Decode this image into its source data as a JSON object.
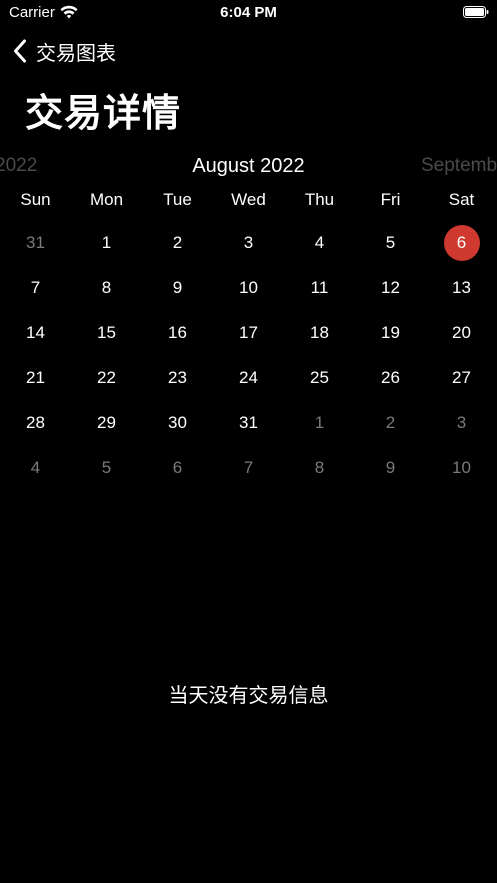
{
  "status_bar": {
    "carrier": "Carrier",
    "time": "6:04 PM"
  },
  "nav": {
    "back_label": "交易图表",
    "title": "交易详情"
  },
  "calendar": {
    "prev_month": "2022",
    "current_month": "August 2022",
    "next_month": "Septemb",
    "weekdays": [
      "Sun",
      "Mon",
      "Tue",
      "Wed",
      "Thu",
      "Fri",
      "Sat"
    ],
    "weeks": [
      [
        {
          "d": "31",
          "in_month": false
        },
        {
          "d": "1",
          "in_month": true
        },
        {
          "d": "2",
          "in_month": true
        },
        {
          "d": "3",
          "in_month": true
        },
        {
          "d": "4",
          "in_month": true
        },
        {
          "d": "5",
          "in_month": true
        },
        {
          "d": "6",
          "in_month": true,
          "selected": true
        }
      ],
      [
        {
          "d": "7",
          "in_month": true
        },
        {
          "d": "8",
          "in_month": true
        },
        {
          "d": "9",
          "in_month": true
        },
        {
          "d": "10",
          "in_month": true
        },
        {
          "d": "11",
          "in_month": true
        },
        {
          "d": "12",
          "in_month": true
        },
        {
          "d": "13",
          "in_month": true
        }
      ],
      [
        {
          "d": "14",
          "in_month": true
        },
        {
          "d": "15",
          "in_month": true
        },
        {
          "d": "16",
          "in_month": true
        },
        {
          "d": "17",
          "in_month": true
        },
        {
          "d": "18",
          "in_month": true
        },
        {
          "d": "19",
          "in_month": true
        },
        {
          "d": "20",
          "in_month": true
        }
      ],
      [
        {
          "d": "21",
          "in_month": true
        },
        {
          "d": "22",
          "in_month": true
        },
        {
          "d": "23",
          "in_month": true
        },
        {
          "d": "24",
          "in_month": true
        },
        {
          "d": "25",
          "in_month": true
        },
        {
          "d": "26",
          "in_month": true
        },
        {
          "d": "27",
          "in_month": true
        }
      ],
      [
        {
          "d": "28",
          "in_month": true
        },
        {
          "d": "29",
          "in_month": true
        },
        {
          "d": "30",
          "in_month": true
        },
        {
          "d": "31",
          "in_month": true
        },
        {
          "d": "1",
          "in_month": false
        },
        {
          "d": "2",
          "in_month": false
        },
        {
          "d": "3",
          "in_month": false
        }
      ],
      [
        {
          "d": "4",
          "in_month": false
        },
        {
          "d": "5",
          "in_month": false
        },
        {
          "d": "6",
          "in_month": false
        },
        {
          "d": "7",
          "in_month": false
        },
        {
          "d": "8",
          "in_month": false
        },
        {
          "d": "9",
          "in_month": false
        },
        {
          "d": "10",
          "in_month": false
        }
      ]
    ],
    "selected_color": "#d0392f",
    "other_month_color": "#7a7a7a"
  },
  "empty_message": "当天没有交易信息",
  "icons": {
    "wifi": "wifi-icon",
    "battery": "battery-icon",
    "back": "chevron-left-icon"
  }
}
